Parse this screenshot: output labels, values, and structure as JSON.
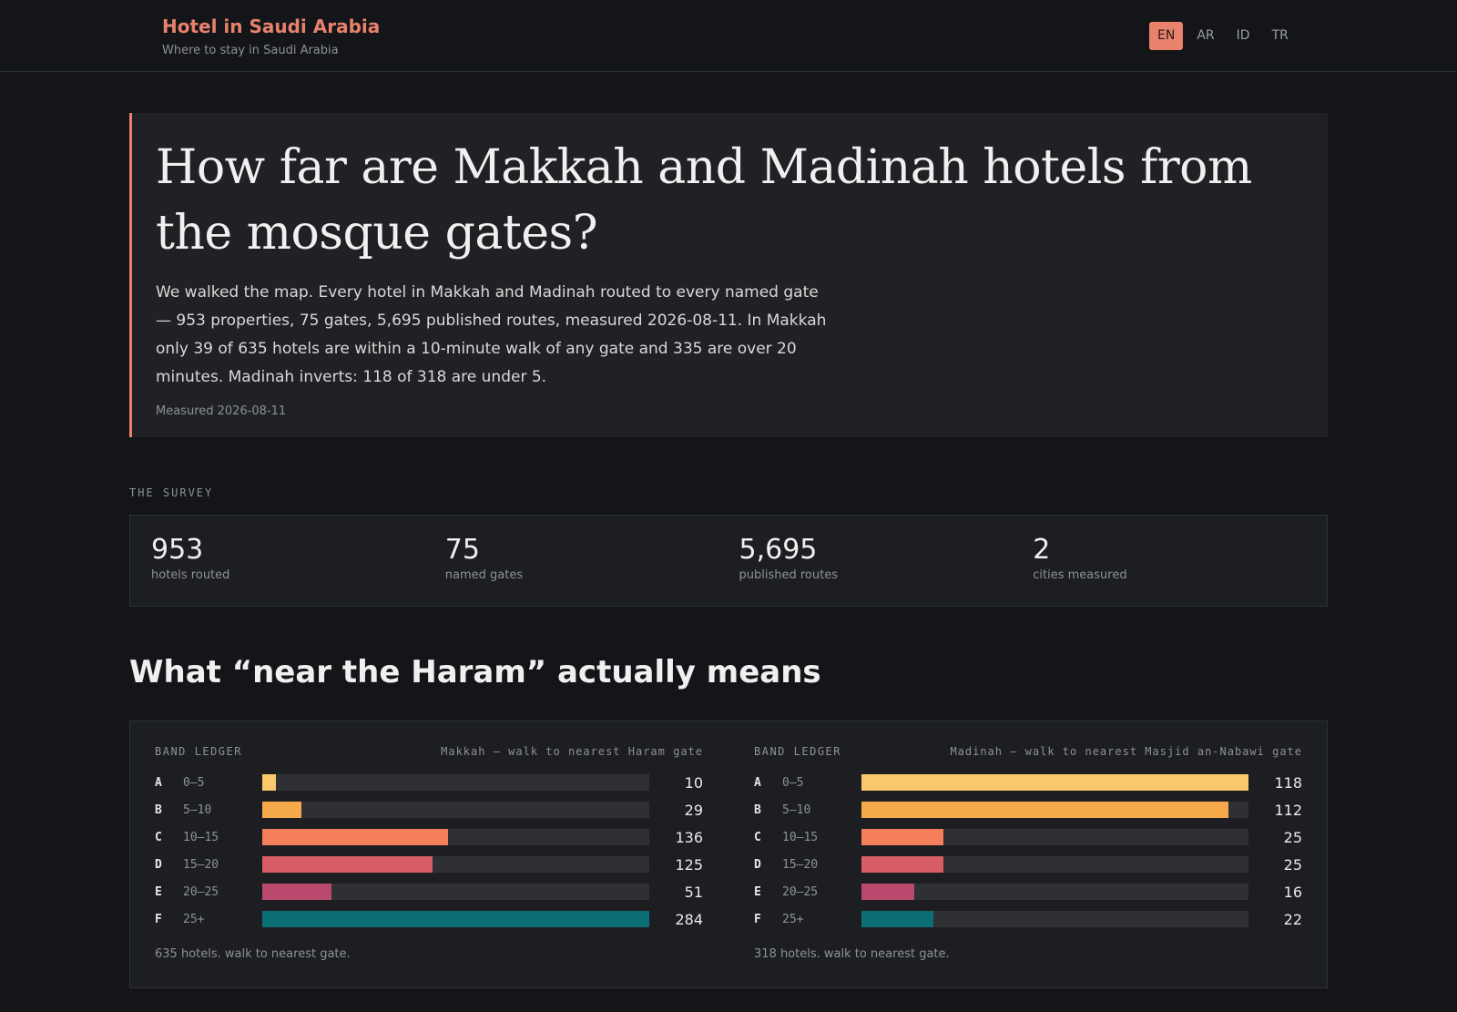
{
  "header": {
    "title": "Hotel in Saudi Arabia",
    "subtitle": "Where to stay in Saudi Arabia",
    "languages": [
      "EN",
      "AR",
      "ID",
      "TR"
    ],
    "active_language": "EN"
  },
  "hero": {
    "title": "How far are Makkah and Madinah hotels from the mosque gates?",
    "lede": "We walked the map. Every hotel in Makkah and Madinah routed to every named gate — 953 properties, 75 gates, 5,695 published routes, measured 2026-08-11. In Makkah only 39 of 635 hotels are within a 10-minute walk of any gate and 335 are over 20 minutes. Madinah inverts: 118 of 318 are under 5.",
    "measured": "Measured 2026-08-11"
  },
  "survey": {
    "label": "THE SURVEY",
    "stats": [
      {
        "value": "953",
        "label": "hotels routed"
      },
      {
        "value": "75",
        "label": "named gates"
      },
      {
        "value": "5,695",
        "label": "published routes"
      },
      {
        "value": "2",
        "label": "cities measured"
      }
    ]
  },
  "section": {
    "title": "What “near the Haram” actually means"
  },
  "colors": {
    "accent": "#e8826d",
    "bands": [
      "#f9c86a",
      "#f6a94a",
      "#f47f5a",
      "#d95d66",
      "#b94a6e",
      "#0b6e74"
    ]
  },
  "chart_data": [
    {
      "type": "bar",
      "label": "BAND LEDGER",
      "title": "Makkah — walk to nearest Haram gate",
      "letters": [
        "A",
        "B",
        "C",
        "D",
        "E",
        "F"
      ],
      "categories": [
        "0–5",
        "5–10",
        "10–15",
        "15–20",
        "20–25",
        "25+"
      ],
      "values": [
        10,
        29,
        136,
        125,
        51,
        284
      ],
      "footer": "635 hotels. walk to nearest gate."
    },
    {
      "type": "bar",
      "label": "BAND LEDGER",
      "title": "Madinah — walk to nearest Masjid an-Nabawi gate",
      "letters": [
        "A",
        "B",
        "C",
        "D",
        "E",
        "F"
      ],
      "categories": [
        "0–5",
        "5–10",
        "10–15",
        "15–20",
        "20–25",
        "25+"
      ],
      "values": [
        118,
        112,
        25,
        25,
        16,
        22
      ],
      "footer": "318 hotels. walk to nearest gate."
    }
  ]
}
